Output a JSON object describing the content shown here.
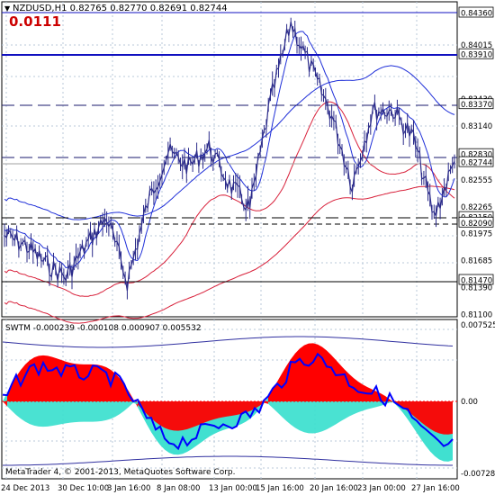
{
  "window": {
    "title": "NZDUSD,H1",
    "ohlc": "0.82765 0.82770 0.82691 0.82744",
    "spread_badge": "0.0111",
    "footer": "MetaTrader 4, © 2001-2013, MetaQuotes Software Corp."
  },
  "colors": {
    "background": "#ffffff",
    "grid": "#b9c8d8",
    "price_line": "#2b2b8a",
    "blue_ma": "#1f2fd8",
    "red_ma": "#d8203a",
    "level_line": "#1010c0",
    "indicator_red": "#ff0000",
    "indicator_cyan": "#40e0d0",
    "indicator_line": "#0000ff",
    "badge": "#cc0000"
  },
  "price_axis": {
    "labels": [
      "0.84360",
      "0.84015",
      "0.83910",
      "0.83430",
      "0.83370",
      "0.83140",
      "0.82830",
      "0.82744",
      "0.82555",
      "0.82265",
      "0.82150",
      "0.82090",
      "0.81975",
      "0.81685",
      "0.81470",
      "0.81390",
      "0.81100"
    ],
    "highlighted": [
      "0.84360",
      "0.83910",
      "0.83370",
      "0.82830",
      "0.82744",
      "0.82150",
      "0.82090",
      "0.81470"
    ]
  },
  "indicator": {
    "header": "SWTM -0.000239 -0.000108 0.000907 0.005532",
    "axis_labels": [
      "0.007525",
      "0.00",
      "-0.007288"
    ]
  },
  "time_axis": {
    "labels": [
      "24 Dec 2013",
      "30 Dec 10:00",
      "3 Jan 16:00",
      "8 Jan 08:00",
      "13 Jan 00:00",
      "15 Jan 16:00",
      "20 Jan 16:00",
      "23 Jan 00:00",
      "27 Jan 16:00"
    ]
  },
  "chart_data": [
    {
      "type": "line",
      "title": "NZDUSD,H1",
      "series": [
        {
          "name": "NZDUSD",
          "x": [
            0,
            5,
            10,
            15,
            20,
            25,
            30,
            35,
            40,
            45,
            50,
            55,
            60,
            65,
            70,
            75,
            80,
            85,
            90,
            95,
            100,
            105,
            110
          ],
          "values": [
            0.8195,
            0.8185,
            0.8165,
            0.815,
            0.8185,
            0.8215,
            0.8145,
            0.823,
            0.8285,
            0.827,
            0.829,
            0.825,
            0.8225,
            0.834,
            0.8425,
            0.8375,
            0.8325,
            0.825,
            0.833,
            0.833,
            0.83,
            0.8215,
            0.8275
          ]
        }
      ],
      "ylim": [
        0.811,
        0.8436
      ]
    },
    {
      "type": "area",
      "title": "SWTM",
      "ylim": [
        -0.007288,
        0.007525
      ]
    }
  ]
}
